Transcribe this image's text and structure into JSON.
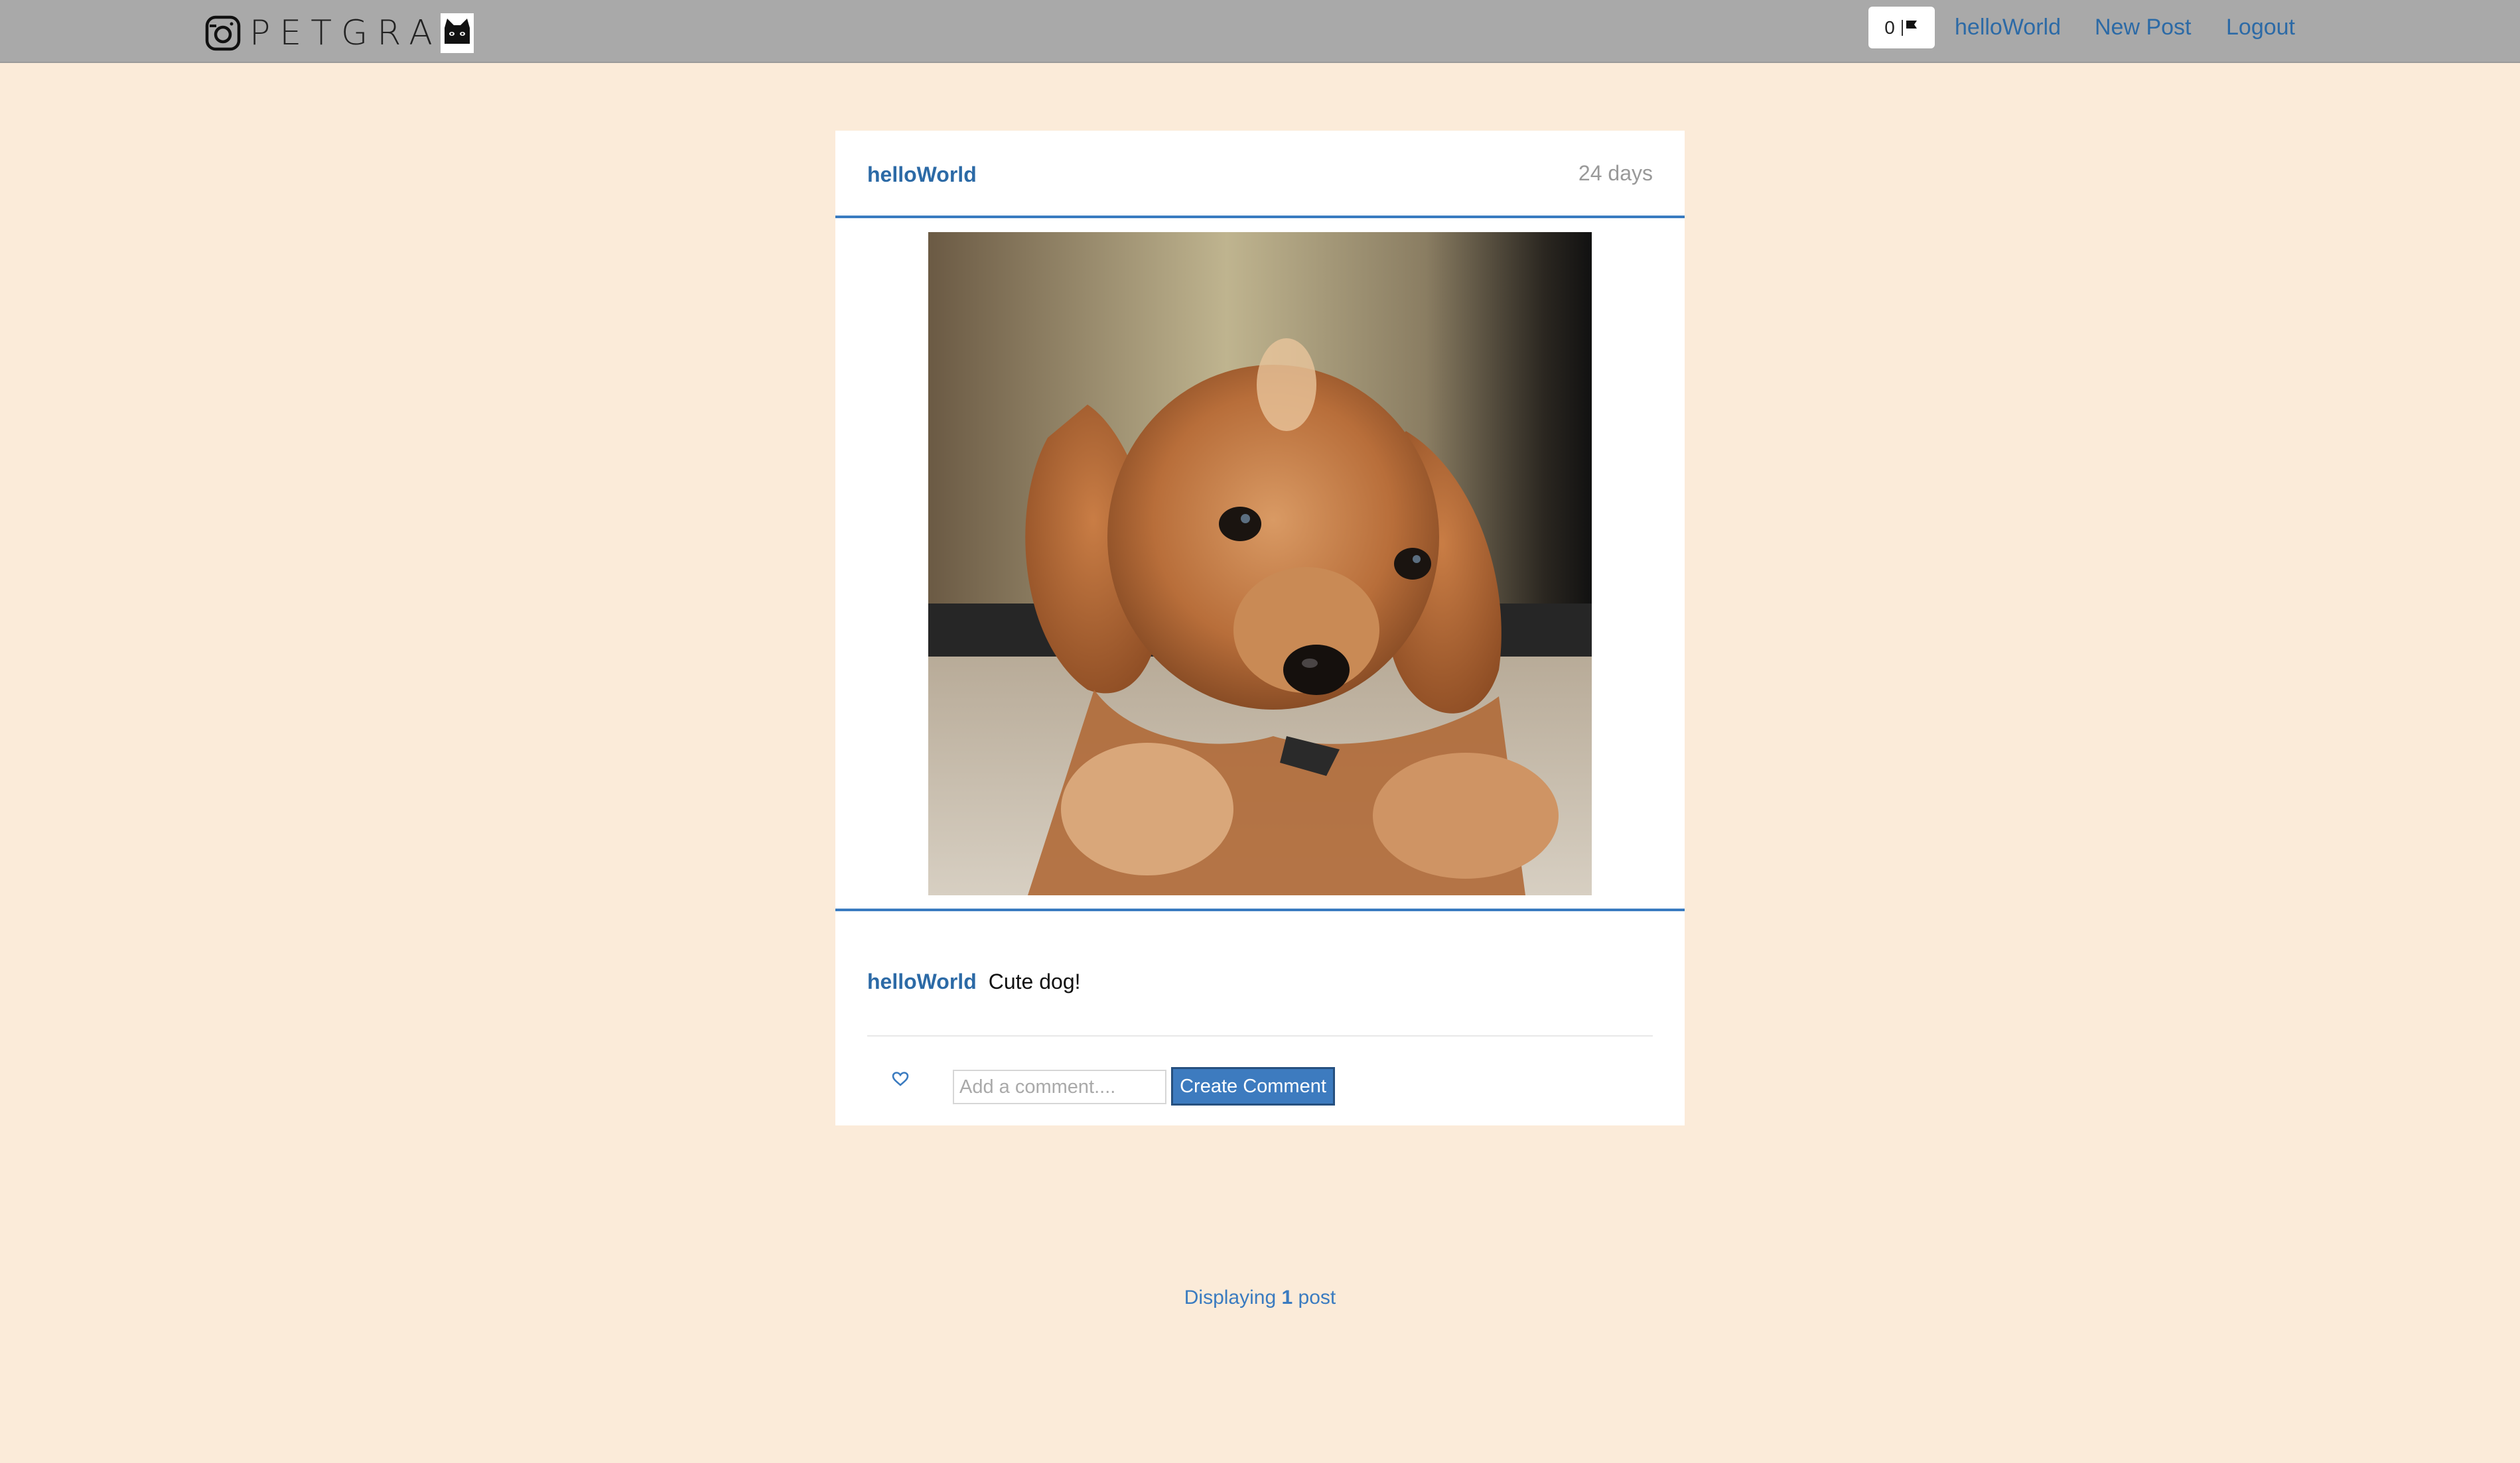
{
  "navbar": {
    "brand_text": "PETGRA",
    "flag_count": "0",
    "links": {
      "user": "helloWorld",
      "new_post": "New Post",
      "logout": "Logout"
    }
  },
  "post": {
    "username": "helloWorld",
    "age": "24 days",
    "image_alt": "Brown puppy lying on carpet",
    "comments": [
      {
        "user": "helloWorld",
        "text": "Cute dog!"
      }
    ],
    "comment_input": {
      "placeholder": "Add a comment....",
      "value": ""
    },
    "create_comment_label": "Create Comment"
  },
  "pagination": {
    "prefix": "Displaying",
    "count": "1",
    "suffix": "post"
  },
  "colors": {
    "page_background": "#fbebd9",
    "navbar": "#a9a9a9",
    "link": "#2c6aa6",
    "accent_rule": "#3a7bc0",
    "button": "#3d7bbf"
  },
  "icons": {
    "brand": "instagram-camera-icon",
    "brand_cat": "cat-face-icon",
    "flag": "flag-icon",
    "like": "heart-outline-icon"
  }
}
